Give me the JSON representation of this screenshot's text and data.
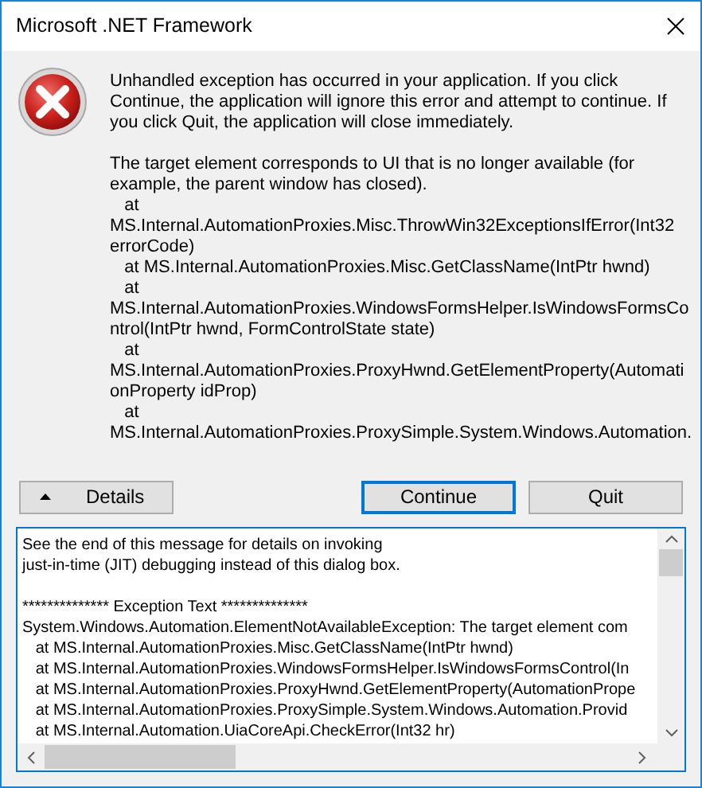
{
  "window": {
    "title": "Microsoft .NET Framework"
  },
  "message": {
    "paragraphs": [
      [
        "Unhandled exception has occurred in your application. If you click",
        "Continue, the application will ignore this error and attempt to continue. If",
        "you click Quit, the application will close immediately."
      ],
      [
        "The target element corresponds to UI that is no longer available (for",
        "example, the parent window has closed).",
        "   at",
        "MS.Internal.AutomationProxies.Misc.ThrowWin32ExceptionsIfError(Int32",
        "errorCode)",
        "   at MS.Internal.AutomationProxies.Misc.GetClassName(IntPtr hwnd)",
        "   at",
        "MS.Internal.AutomationProxies.WindowsFormsHelper.IsWindowsFormsCo",
        "ntrol(IntPtr hwnd, FormControlState state)",
        "   at",
        "MS.Internal.AutomationProxies.ProxyHwnd.GetElementProperty(Automati",
        "onProperty idProp)",
        "   at",
        "MS.Internal.AutomationProxies.ProxySimple.System.Windows.Automation."
      ]
    ]
  },
  "buttons": [
    {
      "label": "Details",
      "kind": "toggle",
      "expanded": true,
      "default": false
    },
    {
      "label": "Continue",
      "kind": "push",
      "default": true
    },
    {
      "label": "Quit",
      "kind": "push",
      "default": false
    }
  ],
  "details": {
    "paragraphs": [
      [
        "See the end of this message for details on invoking",
        "just-in-time (JIT) debugging instead of this dialog box."
      ],
      [
        "************** Exception Text **************",
        "System.Windows.Automation.ElementNotAvailableException: The target element com",
        "   at MS.Internal.AutomationProxies.Misc.GetClassName(IntPtr hwnd)",
        "   at MS.Internal.AutomationProxies.WindowsFormsHelper.IsWindowsFormsControl(In",
        "   at MS.Internal.AutomationProxies.ProxyHwnd.GetElementProperty(AutomationPrope",
        "   at MS.Internal.AutomationProxies.ProxySimple.System.Windows.Automation.Provid",
        "   at MS.Internal.Automation.UiaCoreApi.CheckError(Int32 hr)"
      ]
    ]
  }
}
